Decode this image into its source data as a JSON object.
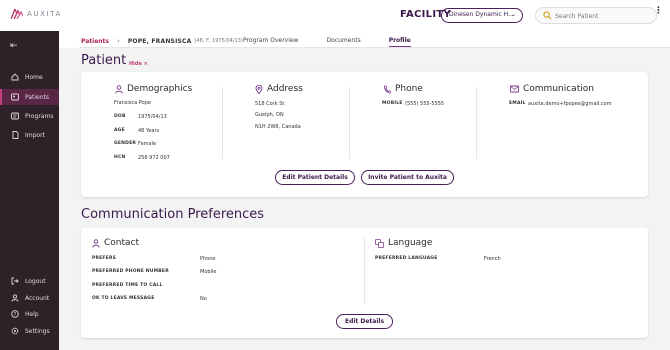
{
  "app": {
    "logo_text": "AUXITA"
  },
  "header": {
    "facility_label": "FACILITY",
    "facility_value": "Dinesen Dynamic H...",
    "search_placeholder": "Search Patient"
  },
  "sidebar": {
    "items": [
      {
        "label": "Home",
        "icon": "home-icon"
      },
      {
        "label": "Patients",
        "icon": "patients-icon",
        "active": true
      },
      {
        "label": "Programs",
        "icon": "programs-icon"
      },
      {
        "label": "Import",
        "icon": "import-icon"
      }
    ],
    "bottom_items": [
      {
        "label": "Logout",
        "icon": "logout-icon"
      },
      {
        "label": "Account",
        "icon": "account-icon"
      },
      {
        "label": "Help",
        "icon": "help-icon"
      },
      {
        "label": "Settings",
        "icon": "settings-icon"
      }
    ]
  },
  "breadcrumb": {
    "root": "Patients",
    "current": "POPE, FRANSISCA",
    "details": "(48, F, 1975/04/13)"
  },
  "tabs": [
    "Program Overview",
    "Documents",
    "Profile"
  ],
  "patient_section": {
    "title": "Patient",
    "hide_label": "Hide",
    "demographics": {
      "title": "Demographics",
      "name": "Fransisca Pope",
      "fields": [
        {
          "label": "DOB",
          "value": "1975/04/13"
        },
        {
          "label": "AGE",
          "value": "48 Years"
        },
        {
          "label": "GENDER",
          "value": "Female"
        },
        {
          "label": "HCN",
          "value": "258 972 007"
        }
      ]
    },
    "address": {
      "title": "Address",
      "lines": [
        "518 Cork St",
        "Guelph, ON",
        "N1H 2W8, Canada"
      ]
    },
    "phone": {
      "title": "Phone",
      "label": "MOBILE",
      "value": "(555) 555-5555"
    },
    "communication": {
      "title": "Communication",
      "label": "EMAIL",
      "value": "auxita.demo+fpopes@gmail.com"
    },
    "buttons": {
      "edit": "Edit Patient Details",
      "invite": "Invite Patient to Auxita"
    }
  },
  "comm_prefs": {
    "title": "Communication Preferences",
    "contact": {
      "title": "Contact",
      "rows": [
        {
          "label": "PREFERS",
          "value": "Phone"
        },
        {
          "label": "PREFERRED PHONE NUMBER",
          "value": "Mobile"
        },
        {
          "label": "PREFERRED TIME TO CALL",
          "value": ""
        },
        {
          "label": "OK TO LEAVE MESSAGE",
          "value": "No"
        }
      ]
    },
    "language": {
      "title": "Language",
      "label": "PREFERRED LANGUAGE",
      "value": "French"
    },
    "edit_button": "Edit Details"
  },
  "colors": {
    "brand": "#3b1a4a",
    "accent": "#c0407a",
    "sidebar_bg": "#2e2228",
    "sidebar_active": "#5a2646",
    "icon": "#7a3a8a"
  }
}
